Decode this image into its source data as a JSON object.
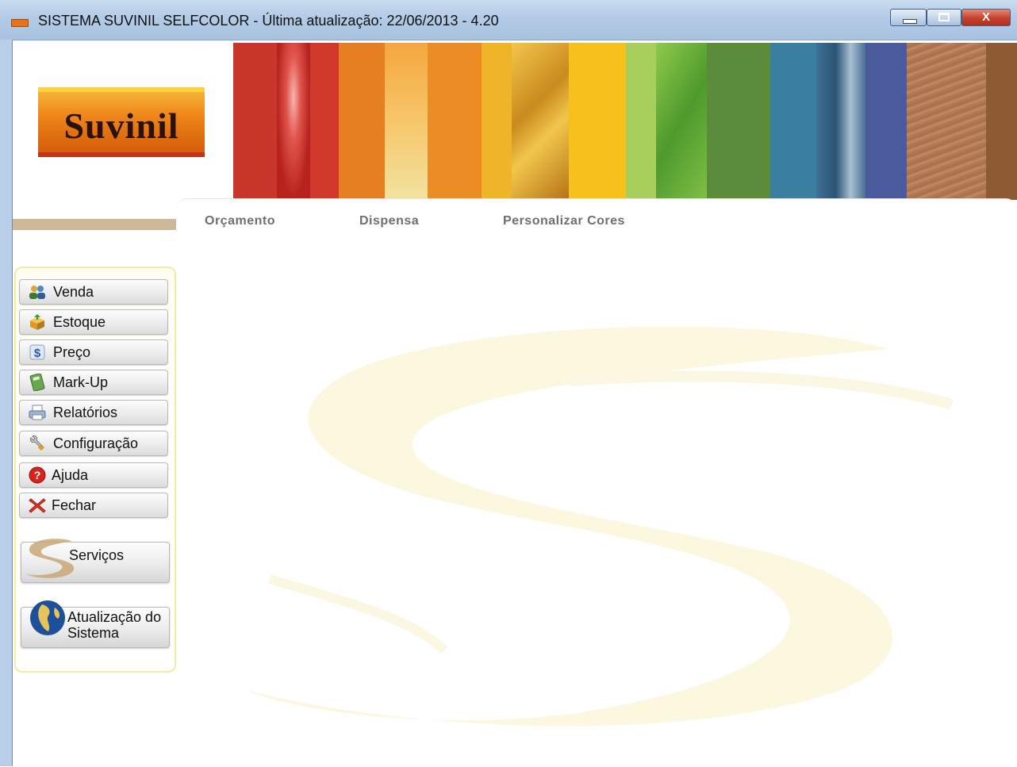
{
  "window": {
    "title": "SISTEMA SUVINIL SELFCOLOR - Última atualização:  22/06/2013 - 4.20",
    "close_glyph": "X"
  },
  "logo": {
    "text": "Suvinil"
  },
  "tabs": [
    {
      "label": "Orçamento"
    },
    {
      "label": "Dispensa"
    },
    {
      "label": "Personalizar Cores"
    }
  ],
  "sidebar": {
    "items": [
      {
        "label": "Venda",
        "icon": "users-icon"
      },
      {
        "label": "Estoque",
        "icon": "box-icon"
      },
      {
        "label": "Preço",
        "icon": "dollar-icon"
      },
      {
        "label": "Mark-Up",
        "icon": "calculator-icon"
      },
      {
        "label": "Relatórios",
        "icon": "printer-icon"
      },
      {
        "label": "Configuração",
        "icon": "wrench-icon"
      },
      {
        "label": "Ajuda",
        "icon": "help-icon"
      },
      {
        "label": "Fechar",
        "icon": "close-icon"
      }
    ],
    "services": {
      "label": "Serviços",
      "icon": "suvinil-s-icon"
    },
    "update": {
      "line1": "Atualização do",
      "line2": "Sistema",
      "icon": "globe-icon"
    }
  },
  "colors": {
    "strips": [
      "#c9362a",
      "#d44a2a",
      "#e67e22",
      "#f2a33a",
      "#eb8c25",
      "#f0b429",
      "#d9a22c",
      "#f7c11c",
      "#a8cf5b",
      "#5fa64a",
      "#5a8c3c",
      "#3b7fa0",
      "#4d7fa8",
      "#4b5a9c",
      "#a7704a",
      "#8e5a34"
    ]
  }
}
